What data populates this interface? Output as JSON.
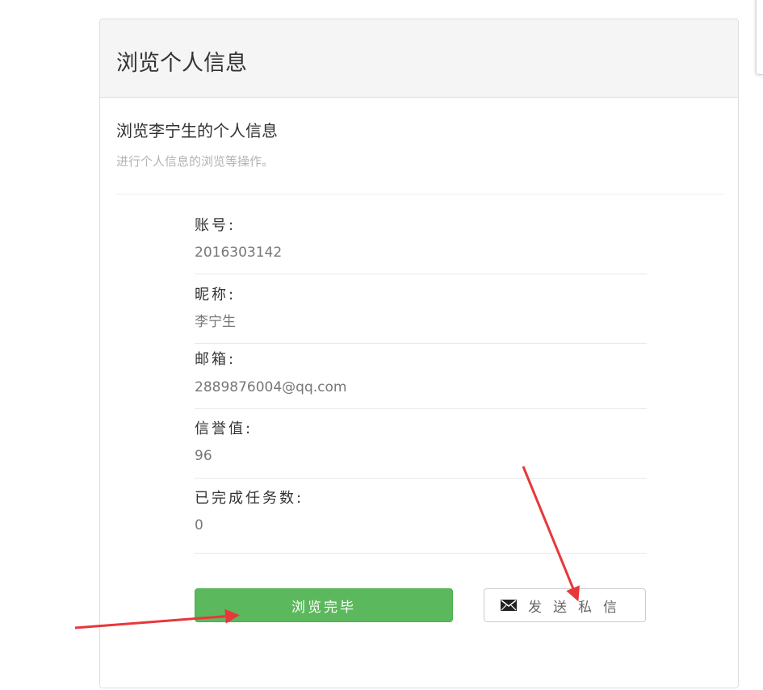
{
  "panel": {
    "title": "浏览个人信息",
    "subtitle": "浏览李宁生的个人信息",
    "description": "进行个人信息的浏览等操作。"
  },
  "fields": [
    {
      "label": "账号:",
      "value": "2016303142"
    },
    {
      "label": "昵称:",
      "value": "李宁生"
    },
    {
      "label": "邮箱:",
      "value": "2889876004@qq.com"
    },
    {
      "label": "信誉值:",
      "value": "96"
    },
    {
      "label": "已完成任务数:",
      "value": "0"
    }
  ],
  "actions": {
    "done_label": "浏览完毕",
    "message_label": "发送私信",
    "message_icon": "envelope-icon"
  },
  "colors": {
    "success": "#5cb85c",
    "annotation_arrow": "#e8373a"
  }
}
